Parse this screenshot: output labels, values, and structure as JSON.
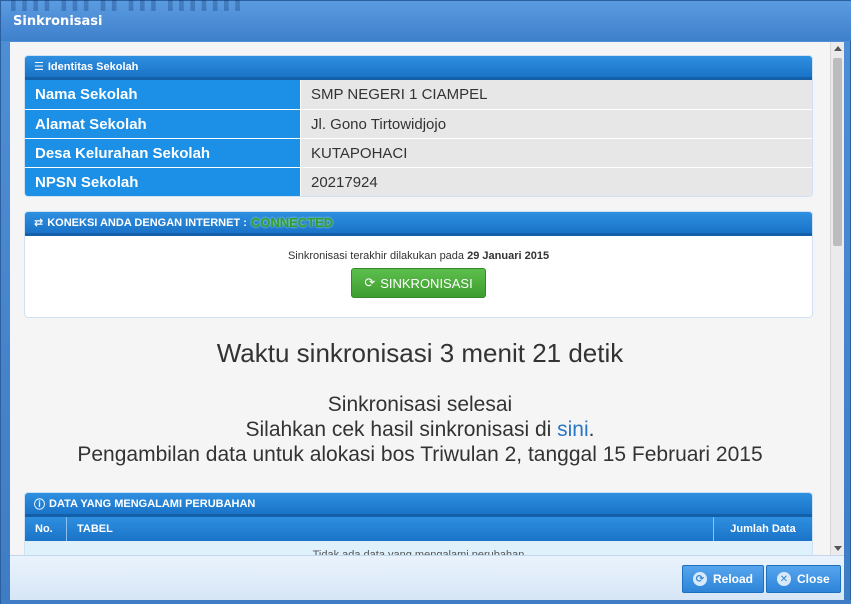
{
  "window": {
    "title": "Sinkronisasi",
    "ghost_title": "▌▌▌▌ ▌▌▌ ▌▌ ▌▌▌ ▌▌▌▌▌▌▌"
  },
  "identitas": {
    "heading": "Identitas Sekolah",
    "rows": [
      {
        "key": "Nama Sekolah",
        "value": "SMP NEGERI 1 CIAMPEL"
      },
      {
        "key": "Alamat Sekolah",
        "value": "Jl. Gono Tirtowidjojo"
      },
      {
        "key": "Desa Kelurahan Sekolah",
        "value": "KUTAPOHACI"
      },
      {
        "key": "NPSN Sekolah",
        "value": "20217924"
      }
    ]
  },
  "koneksi": {
    "heading": "KONEKSI ANDA DENGAN INTERNET :",
    "status": "CONNECTED",
    "status_color": "#2f9e2f",
    "note_prefix": "Sinkronisasi terakhir dilakukan pada",
    "note_date": "29 Januari 2015",
    "sync_button": "SINKRONISASI"
  },
  "result": {
    "time_text": "Waktu sinkronisasi 3 menit 21 detik",
    "line1": "Sinkronisasi selesai",
    "line2_prefix": "Silahkan cek hasil sinkronisasi di",
    "line2_link": "sini",
    "line2_suffix": ".",
    "line3": "Pengambilan data untuk alokasi bos Triwulan 2, tanggal 15 Februari 2015"
  },
  "perubahan": {
    "heading": "DATA YANG MENGALAMI PERUBAHAN",
    "columns": [
      "No.",
      "TABEL",
      "Jumlah Data"
    ],
    "empty_text": "Tidak ada data yang mengalami perubahan"
  },
  "footer": {
    "reload_label": "Reload",
    "close_label": "Close"
  },
  "colors": {
    "accent": "#1c8fe6",
    "sync_green": "#3e9d2f",
    "link": "#2a76c6"
  }
}
